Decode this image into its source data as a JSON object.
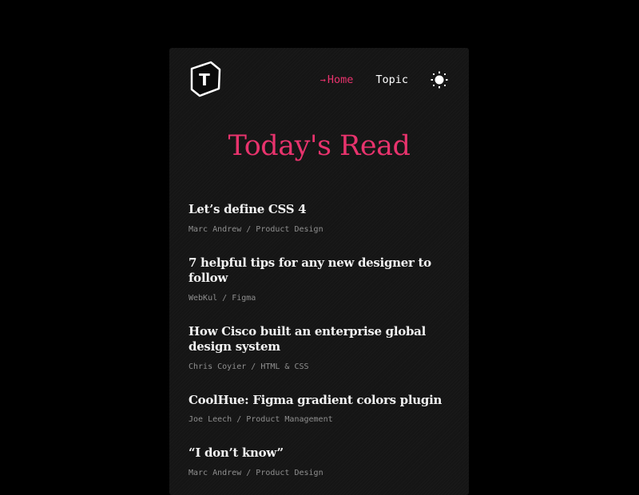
{
  "header": {
    "logo_letter": "T",
    "nav": [
      {
        "label": "Home",
        "active": true,
        "prefix_icon": "arrow-right-icon"
      },
      {
        "label": "Topic",
        "active": false
      }
    ],
    "theme_toggle_icon": "sun-icon"
  },
  "page": {
    "title": "Today's Read"
  },
  "colors": {
    "accent": "#e8336d",
    "background": "#000000",
    "card": "#151515",
    "text": "#f2f2f2",
    "meta": "#8f8f8f"
  },
  "articles": [
    {
      "title": "Let’s define CSS 4",
      "author": "Marc Andrew",
      "topic": "Product Design"
    },
    {
      "title": "7 helpful tips for any new designer to follow",
      "author": "WebKul",
      "topic": "Figma"
    },
    {
      "title": "How Cisco built an enterprise global design system",
      "author": "Chris Coyier",
      "topic": "HTML & CSS"
    },
    {
      "title": "CoolHue: Figma gradient colors plugin",
      "author": "Joe Leech",
      "topic": "Product Management"
    },
    {
      "title": "“I don’t know”",
      "author": "Marc Andrew",
      "topic": "Product Design"
    }
  ],
  "meta_separator": " / "
}
